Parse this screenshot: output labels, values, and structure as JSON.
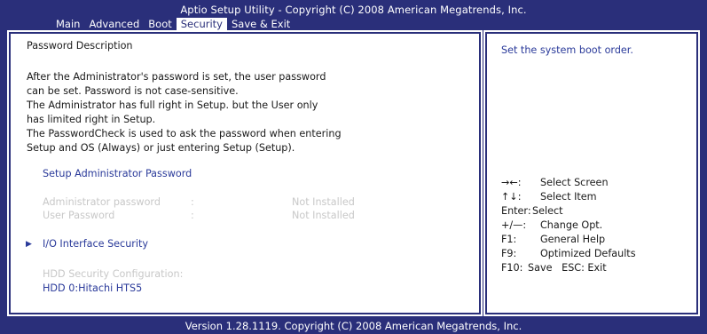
{
  "header": {
    "title": "Aptio Setup Utility - Copyright (C) 2008 American Megatrends, Inc.",
    "tabs": [
      "Main",
      "Advanced",
      "Boot",
      "Security",
      "Save & Exit"
    ],
    "active_tab": "Security"
  },
  "left_panel": {
    "section_title": "Password Description",
    "description": [
      "After the Administrator's password is set, the user password",
      "can be set. Password is not case-sensitive.",
      "The Administrator has full right in Setup. but the User only",
      "has limited right in Setup.",
      "The PasswordCheck is used to ask the password when entering",
      "Setup and OS (Always) or just entering Setup (Setup)."
    ],
    "setup_admin_password": "Setup Administrator Password",
    "admin_password": {
      "label": "Administrator password",
      "separator": ":",
      "value": "Not Installed"
    },
    "user_password": {
      "label": "User Password",
      "separator": ":",
      "value": "Not Installed"
    },
    "io_interface_security": "I/O Interface Security",
    "hdd_security_configuration": "HDD Security Configuration:",
    "hdd_item": "HDD 0:Hitachi HTS5"
  },
  "right_panel": {
    "help_text": "Set the system boot order.",
    "keys": [
      {
        "key": "→←:",
        "desc": "Select Screen"
      },
      {
        "key": "↑↓:",
        "desc": "Select Item"
      },
      {
        "key": "Enter:",
        "desc": "Select"
      },
      {
        "key": "+/—:",
        "desc": "Change Opt."
      },
      {
        "key": "F1:",
        "desc": "General Help"
      },
      {
        "key": "F9:",
        "desc": "Optimized Defaults"
      },
      {
        "key": "F10:",
        "desc": "Save   ESC: Exit"
      }
    ]
  },
  "footer": "Version 1.28.1119. Copyright (C) 2008 American Megatrends, Inc.",
  "colors": {
    "background": "#2a2f7a",
    "panel": "#ffffff",
    "accent_text": "#2a3a9a",
    "disabled_text": "#c8c8c8"
  }
}
